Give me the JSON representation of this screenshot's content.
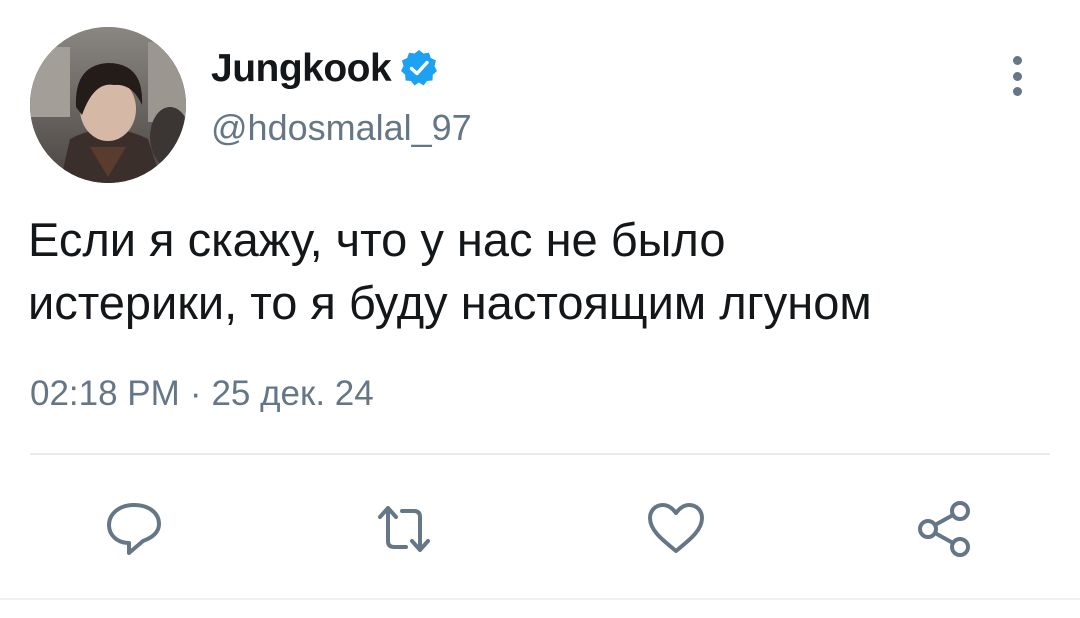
{
  "tweet": {
    "author": {
      "name": "Jungkook",
      "handle": "@hdosmalal_97",
      "verified": true,
      "verified_color": "#1da1f2"
    },
    "text": "Если я скажу, что у нас не было\nистерики, то я буду настоящим лгуном",
    "time": "02:18 PM",
    "separator": "·",
    "date": "25 дек. 24"
  },
  "actions": [
    {
      "icon": "reply-icon"
    },
    {
      "icon": "retweet-icon"
    },
    {
      "icon": "like-icon"
    },
    {
      "icon": "share-icon"
    }
  ],
  "colors": {
    "text": "#14171a",
    "secondary": "#657786",
    "divider": "#e6ecf0"
  }
}
